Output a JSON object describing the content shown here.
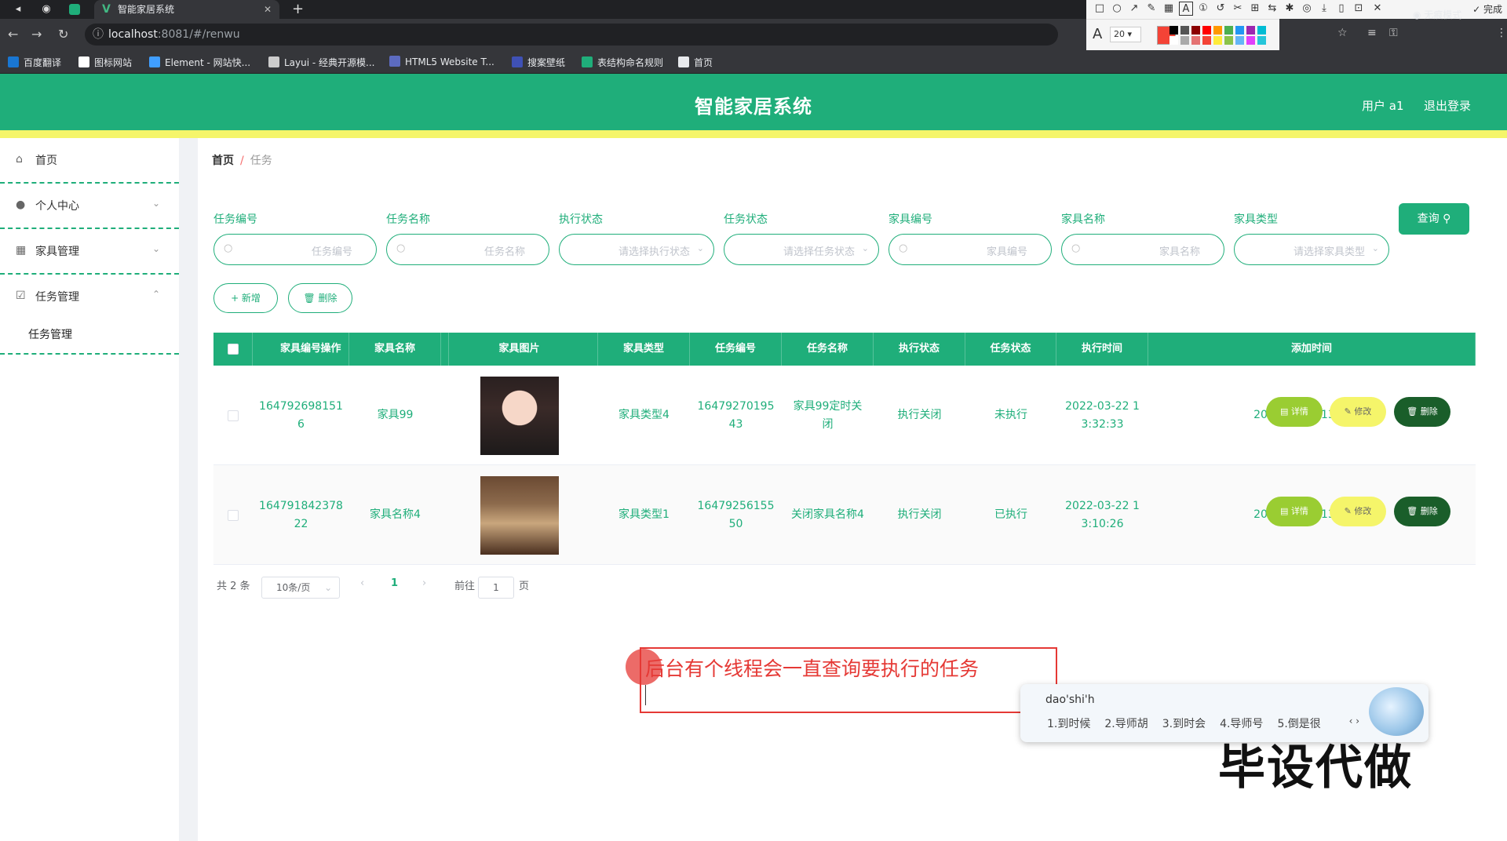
{
  "browser": {
    "tab_title": "智能家居系统",
    "new_tab": "+",
    "url_host": "localhost",
    "url_path": ":8081/#/renwu",
    "incognito_label": "无痕模式",
    "bookmarks": [
      {
        "label": "百度翻译",
        "color": "#1976d2"
      },
      {
        "label": "图标网站",
        "color": "#ffffff"
      },
      {
        "label": "Element - 网站快...",
        "color": "#409eff"
      },
      {
        "label": "Layui - 经典开源模...",
        "color": "#cccccc"
      },
      {
        "label": "HTML5 Website T...",
        "color": "#5c6bc0"
      },
      {
        "label": "搜案壁纸",
        "color": "#3f51b5"
      },
      {
        "label": "表结构命名规则",
        "color": "#1fae7a"
      },
      {
        "label": "首页",
        "color": "#e8eaed"
      }
    ]
  },
  "annotation_toolbar": {
    "done_label": "完成",
    "font_size": "20",
    "current_color": "#f44336",
    "swatches": [
      "#000000",
      "#555555",
      "#8b0000",
      "#ff0000",
      "#ff9800",
      "#4caf50",
      "#2196f3",
      "#9c27b0",
      "#00bcd4",
      "#ffffff",
      "#aaaaaa",
      "#e57373",
      "#f44336",
      "#ffeb3b",
      "#8bc34a",
      "#64b5f6",
      "#e040fb",
      "#26c6da"
    ]
  },
  "app": {
    "title": "智能家居系统",
    "user": "用户 a1",
    "logout": "退出登录",
    "primary_color": "#1fae7a"
  },
  "sidebar": {
    "items": [
      {
        "label": "首页",
        "icon": "home-icon"
      },
      {
        "label": "个人中心",
        "icon": "user-icon"
      },
      {
        "label": "家具管理",
        "icon": "grid-icon"
      },
      {
        "label": "任务管理",
        "icon": "checkbox-icon"
      }
    ],
    "sub_item": "任务管理"
  },
  "breadcrumb": {
    "home": "首页",
    "sep": "/",
    "current": "任务"
  },
  "filters": [
    {
      "label": "任务编号",
      "placeholder": "任务编号",
      "type": "input"
    },
    {
      "label": "任务名称",
      "placeholder": "任务名称",
      "type": "input"
    },
    {
      "label": "执行状态",
      "placeholder": "请选择执行状态",
      "type": "select"
    },
    {
      "label": "任务状态",
      "placeholder": "请选择任务状态",
      "type": "select"
    },
    {
      "label": "家具编号",
      "placeholder": "家具编号",
      "type": "input"
    },
    {
      "label": "家具名称",
      "placeholder": "家具名称",
      "type": "input"
    },
    {
      "label": "家具类型",
      "placeholder": "请选择家具类型",
      "type": "select"
    }
  ],
  "query_label": "查询",
  "actions": {
    "add": "+ 新增",
    "delete": "删除"
  },
  "table": {
    "headers": [
      "家具编号",
      "家具名称",
      "家具图片",
      "家具类型",
      "任务编号",
      "任务名称",
      "执行状态",
      "任务状态",
      "执行时间",
      "添加时间",
      "操作"
    ],
    "rows": [
      {
        "furniture_no": "1647926981516",
        "furniture_name": "家具99",
        "image": "girl",
        "type": "家具类型4",
        "task_no": "1647927019543",
        "task_name": "家具99定时关闭",
        "exec_state": "执行关闭",
        "task_state": "未执行",
        "exec_time": "2022-03-22 13:32:33",
        "add_time": "2022-03-22 13:30:38"
      },
      {
        "furniture_no": "164791842378 22",
        "furniture_name": "家具名称4",
        "image": "room",
        "type": "家具类型1",
        "task_no": "1647925615550",
        "task_name": "关闭家具名称4",
        "exec_state": "执行关闭",
        "task_state": "已执行",
        "exec_time": "2022-03-22 13:10:26",
        "add_time": "2022-03-22 13:07:37"
      }
    ],
    "ops": {
      "detail": "详情",
      "edit": "修改",
      "delete": "删除"
    }
  },
  "pagination": {
    "total": "共 2 条",
    "page_size": "10条/页",
    "prev": "‹",
    "current": "1",
    "next": "›",
    "goto_label": "前往",
    "goto_value": "1",
    "page_suffix": "页"
  },
  "overlay": {
    "annotation_text": "后台有个线程会一直查询要执行的任务",
    "ime_pinyin": "dao'shi'h",
    "ime_candidates": [
      "1.到时候",
      "2.导师胡",
      "3.到时会",
      "4.导师号",
      "5.倒是很"
    ],
    "watermark": "毕设代做"
  }
}
